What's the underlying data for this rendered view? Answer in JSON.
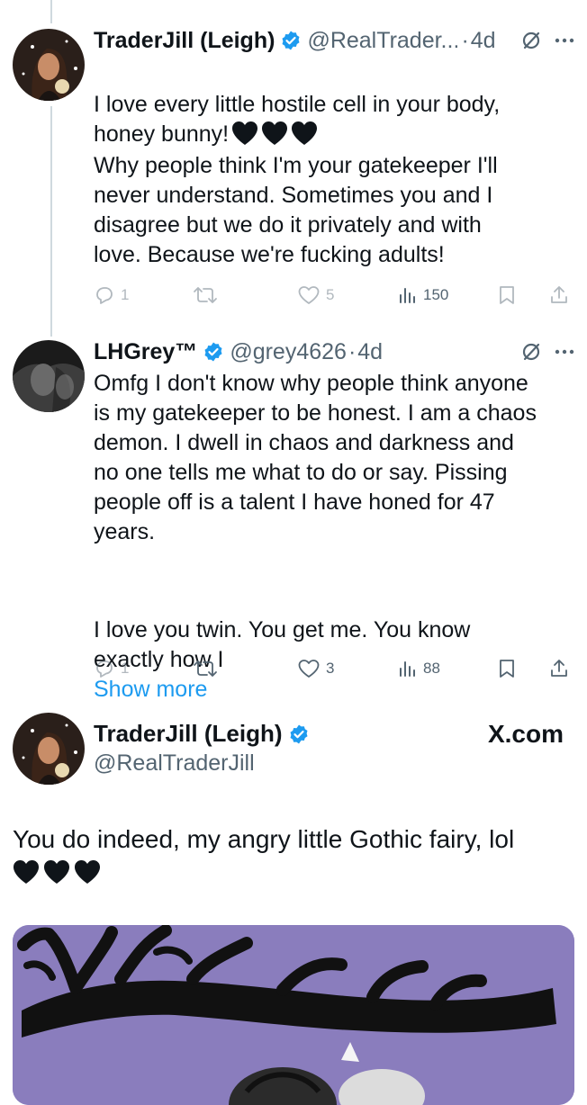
{
  "tweet1": {
    "name": "TraderJill (Leigh)",
    "handle": "@RealTrader...",
    "separator": "·",
    "time": "4d",
    "text_line1": "I love every little hostile cell in your body,\nhoney bunny!",
    "hearts": [
      "black-heart",
      "black-heart",
      "black-heart"
    ],
    "text_paragraph2": "Why people think I'm your gatekeeper I'll\nnever understand. Sometimes you and I\ndisagree but we do it privately and with\nlove. Because we're fucking adults!",
    "replies": "1",
    "likes": "5",
    "views": "150"
  },
  "tweet2": {
    "name": "LHGrey™",
    "handle": "@grey4626",
    "separator": "·",
    "time": "4d",
    "text_paragraph1": "Omfg I don't know why people think anyone\nis my gatekeeper to be honest. I am a chaos\ndemon. I dwell in chaos and darkness and\nno one tells me what to do or say. Pissing\npeople off is a talent I have honed for 47\nyears.",
    "text_paragraph2": "I love you twin. You get me. You know\nexactly how I",
    "show_more": "Show more",
    "replies": "1",
    "likes": "3",
    "views": "88"
  },
  "quote": {
    "name": "TraderJill (Leigh)",
    "handle": "@RealTraderJill",
    "brand": "X.com",
    "text": "You do indeed, my angry little Gothic fairy, lol",
    "hearts": [
      "black-heart",
      "black-heart",
      "black-heart"
    ],
    "media_background": "#8a7dbd"
  },
  "colors": {
    "verified": "#1d9bf0",
    "link": "#1d9bf0",
    "secondary_text": "#536471",
    "thread_line": "#cfd9de"
  }
}
